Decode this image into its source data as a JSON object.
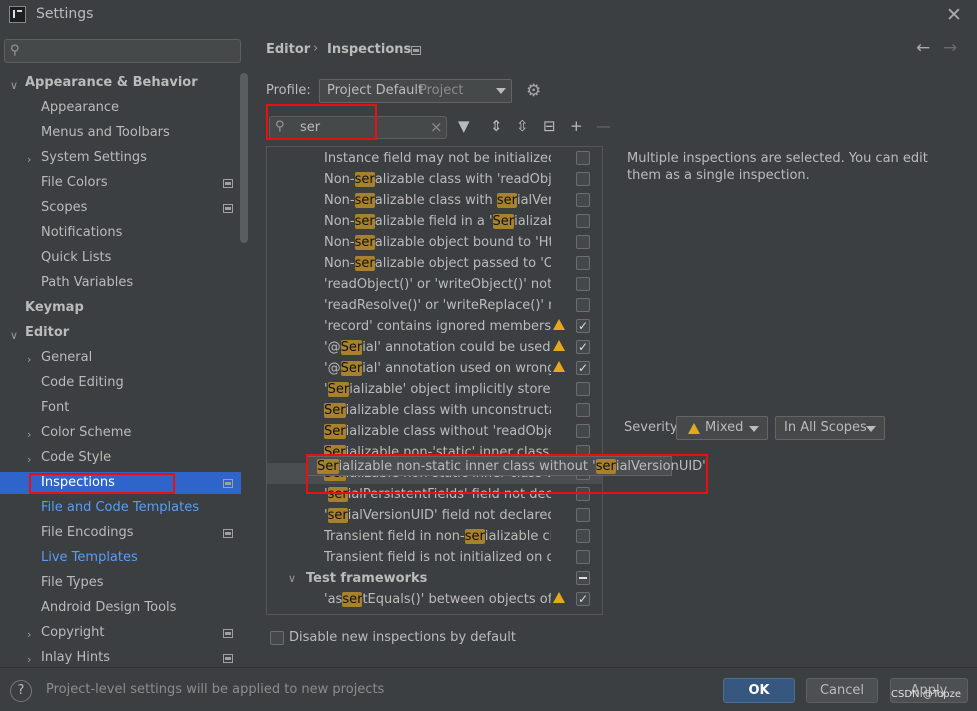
{
  "window": {
    "title": "Settings"
  },
  "sidebar": {
    "search_placeholder": "",
    "items": [
      {
        "label": "Appearance & Behavior"
      },
      {
        "label": "Appearance"
      },
      {
        "label": "Menus and Toolbars"
      },
      {
        "label": "System Settings"
      },
      {
        "label": "File Colors"
      },
      {
        "label": "Scopes"
      },
      {
        "label": "Notifications"
      },
      {
        "label": "Quick Lists"
      },
      {
        "label": "Path Variables"
      },
      {
        "label": "Keymap"
      },
      {
        "label": "Editor"
      },
      {
        "label": "General"
      },
      {
        "label": "Code Editing"
      },
      {
        "label": "Font"
      },
      {
        "label": "Color Scheme"
      },
      {
        "label": "Code Style"
      },
      {
        "label": "Inspections"
      },
      {
        "label": "File and Code Templates"
      },
      {
        "label": "File Encodings"
      },
      {
        "label": "Live Templates"
      },
      {
        "label": "File Types"
      },
      {
        "label": "Android Design Tools"
      },
      {
        "label": "Copyright"
      },
      {
        "label": "Inlay Hints"
      }
    ]
  },
  "breadcrumb": {
    "parent": "Editor",
    "current": "Inspections"
  },
  "profile": {
    "label": "Profile:",
    "value": "Project Default",
    "scope": "Project"
  },
  "inspection_search": {
    "value": "ser"
  },
  "inspections": [
    {
      "text": "Instance field may not be initialized by"
    },
    {
      "pre": "Non-",
      "hl": "ser",
      "post": "alizable class with 'readObject"
    },
    {
      "pre": "Non-",
      "hl": "ser",
      "post": "alizable class with ",
      "hl2": "ser",
      "post2": "ialVersio"
    },
    {
      "pre": "Non-",
      "hl": "ser",
      "post": "alizable field in a '",
      "hl2": "Ser",
      "post2": "ializable'"
    },
    {
      "pre": "Non-",
      "hl": "ser",
      "post": "alizable object bound to 'Http"
    },
    {
      "pre": "Non-",
      "hl": "ser",
      "post": "alizable object passed to 'Obj"
    },
    {
      "text": "'readObject()' or 'writeObject()' not dec"
    },
    {
      "text": "'readResolve()' or 'writeReplace()' not c"
    },
    {
      "text": "'record' contains ignored members"
    },
    {
      "pre": "'@",
      "hl": "Ser",
      "post": "ial' annotation could be used"
    },
    {
      "pre": "'@",
      "hl": "Ser",
      "post": "ial' annotation used on wrong me"
    },
    {
      "pre": "'",
      "hl": "Ser",
      "post": "ializable' object implicitly stores no"
    },
    {
      "pre": "",
      "hl": "Ser",
      "post": "ializable class with unconstructable"
    },
    {
      "pre": "",
      "hl": "Ser",
      "post": "ializable class without 'readObject()"
    },
    {
      "pre": "",
      "hl": "Ser",
      "post": "ializable non-'static' inner class with"
    },
    {
      "pre": "",
      "hl": "Ser",
      "post": "ializable non-static inner class without"
    },
    {
      "pre": "'",
      "hl": "ser",
      "post": "ialPersistentFields' field not declare"
    },
    {
      "pre": "'",
      "hl": "ser",
      "post": "ialVersionUID' field not declared 'p"
    },
    {
      "pre": "Transient field in non-",
      "hl": "ser",
      "post": "ializable class"
    },
    {
      "pre": "Transient field is not initialized on de",
      "hl": "se",
      "post": ""
    },
    {
      "category": "Test frameworks"
    },
    {
      "pre": "'as",
      "hl": "ser",
      "post": "tEquals()' between objects of inco"
    }
  ],
  "tooltip": {
    "pre": "",
    "hl": "Ser",
    "mid": "ializable non-static inner class without '",
    "hl2": "ser",
    "post": "ialVersionUID'"
  },
  "description": "Multiple inspections are selected. You can edit them as a single inspection.",
  "severity": {
    "label": "Severity:",
    "value": "Mixed",
    "scope": "In All Scopes"
  },
  "disable_new": {
    "label": "Disable new inspections by default"
  },
  "footer": {
    "note": "Project-level settings will be applied to new projects",
    "ok": "OK",
    "cancel": "Cancel",
    "apply": "Apply",
    "watermark": "CSDN @Topze"
  },
  "colors": {
    "accent": "#2f65ca",
    "annotation": "#e81010",
    "highlight": "#a8812f",
    "warning": "#e5a81d"
  },
  "icons": [
    "search-icon",
    "gear-icon",
    "filter-icon",
    "expand-all-icon",
    "collapse-all-icon",
    "reset-icon",
    "add-icon",
    "remove-icon",
    "back-arrow-icon",
    "forward-arrow-icon",
    "help-icon",
    "close-icon",
    "warning-icon"
  ]
}
